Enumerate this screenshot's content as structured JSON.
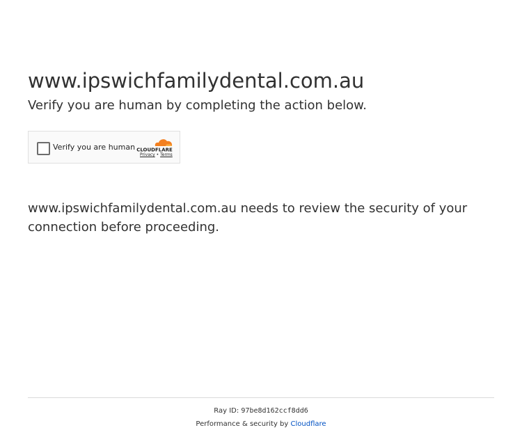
{
  "site": {
    "domain": "www.ipswichfamilydental.com.au",
    "subtitle": "Verify you are human by completing the action below."
  },
  "challenge_widget": {
    "checkbox_label": "Verify you are human",
    "logo_text": "CLOUDFLARE",
    "privacy_link": "Privacy",
    "separator": "•",
    "terms_link": "Terms",
    "logo_color": "#f38020"
  },
  "notice": {
    "text": "www.ipswichfamilydental.com.au needs to review the security of your connection before proceeding."
  },
  "footer": {
    "ray_label": "Ray ID:",
    "ray_id": "97be8d162ccf8dd6",
    "performance_label": "Performance & security by",
    "provider_link": "Cloudflare",
    "link_color": "#0051c3"
  }
}
